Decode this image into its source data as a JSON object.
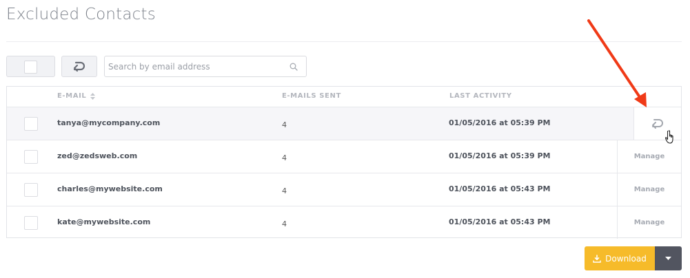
{
  "page": {
    "title": "Excluded Contacts"
  },
  "search": {
    "placeholder": "Search by email address",
    "value": ""
  },
  "table": {
    "columns": {
      "email": "E-MAIL",
      "sent": "E-MAILS SENT",
      "activity": "LAST ACTIVITY"
    },
    "rows": [
      {
        "email": "tanya@mycompany.com",
        "sent": "4",
        "activity": "01/05/2016 at 05:39 PM",
        "action": ""
      },
      {
        "email": "zed@zedsweb.com",
        "sent": "4",
        "activity": "01/05/2016 at 05:39 PM",
        "action": "Manage"
      },
      {
        "email": "charles@mywebsite.com",
        "sent": "4",
        "activity": "01/05/2016 at 05:43 PM",
        "action": "Manage"
      },
      {
        "email": "kate@mywebsite.com",
        "sent": "4",
        "activity": "01/05/2016 at 05:43 PM",
        "action": "Manage"
      }
    ]
  },
  "download": {
    "label": "Download"
  },
  "colors": {
    "accent": "#f6bb2a",
    "dark_button": "#525560",
    "annotation_arrow": "#f03a17"
  }
}
